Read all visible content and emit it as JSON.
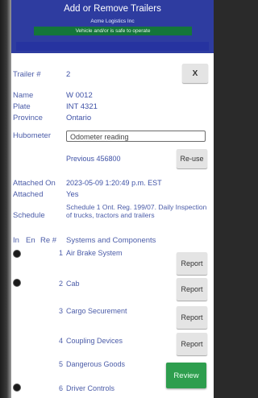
{
  "header": {
    "title": "Add or Remove Trailers",
    "company": "Acme Logistics Inc",
    "status": "Vehicle and/or is safe to operate"
  },
  "trailer": {
    "number_label": "Trailer #",
    "number_value": "2",
    "clear_label": "X",
    "name_label": "Name",
    "name_value": "W 0012",
    "plate_label": "Plate",
    "plate_value": "INT 4321",
    "province_label": "Province",
    "province_value": "Ontario",
    "hubometer_label": "Hubometer",
    "hubometer_placeholder": "Odometer reading",
    "previous_text": "Previous 456800",
    "reuse_label": "Re-use",
    "attached_on_label": "Attached On",
    "attached_on_value": "2023-05-09 1:20:49 p.m. EST",
    "attached_label": "Attached",
    "attached_value": "Yes",
    "schedule_label": "Schedule",
    "schedule_value": "Schedule 1 Ont. Reg. 199/07. Daily Inspection of trucks, tractors and trailers"
  },
  "table": {
    "col_in": "In",
    "col_en": "En",
    "col_re": "Re #",
    "col_sys": "Systems and Components",
    "report_label": "Report",
    "rows": [
      {
        "num": "1",
        "name": "Air Brake System",
        "marked": true
      },
      {
        "num": "2",
        "name": "Cab",
        "marked": true
      },
      {
        "num": "3",
        "name": "Cargo Securement",
        "marked": false
      },
      {
        "num": "4",
        "name": "Coupling Devices",
        "marked": false
      },
      {
        "num": "5",
        "name": "Dangerous Goods",
        "marked": false
      },
      {
        "num": "6",
        "name": "Driver Controls",
        "marked": true
      }
    ]
  },
  "review_label": "Review",
  "colors": {
    "header": "#2e3ca0",
    "status": "#14763a",
    "text": "#4b5ca8",
    "review": "#2e9e4e"
  }
}
